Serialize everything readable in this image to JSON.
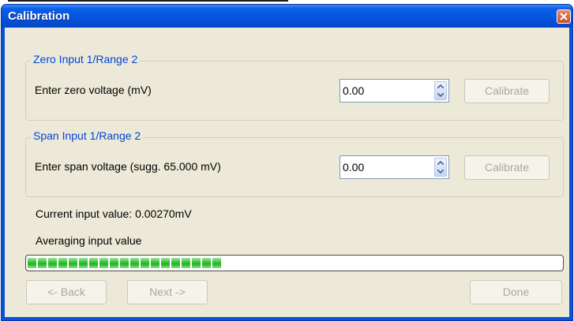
{
  "window": {
    "title": "Calibration"
  },
  "zero_group": {
    "legend": "Zero Input 1/Range 2",
    "prompt": "Enter zero voltage (mV)",
    "value": "0.00",
    "calibrate_label": "Calibrate"
  },
  "span_group": {
    "legend": "Span Input 1/Range 2",
    "prompt": "Enter span voltage (sugg. 65.000 mV)",
    "value": "0.00",
    "calibrate_label": "Calibrate"
  },
  "current_input": "Current input value: 0.00270mV",
  "averaging_label": "Averaging input value",
  "progress": {
    "fraction": 0.36,
    "color": "#33bf33"
  },
  "buttons": {
    "back": "<- Back",
    "next": "Next ->",
    "done": "Done"
  },
  "colors": {
    "titlebar": "#0553dc",
    "legend": "#0046d5",
    "disabled_text": "#aca899"
  }
}
